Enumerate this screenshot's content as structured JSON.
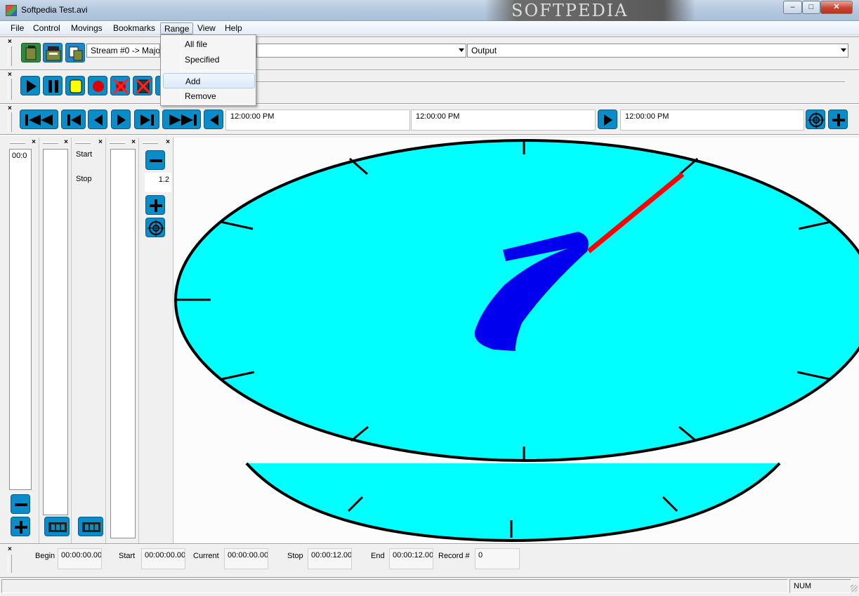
{
  "window": {
    "title": "Softpedia Test.avi",
    "watermark": "SOFTPEDIA",
    "controls": {
      "minimize": "–",
      "maximize": "□",
      "close": "✕"
    }
  },
  "menubar": {
    "items": [
      "File",
      "Control",
      "Movings",
      "Bookmarks",
      "Range",
      "View",
      "Help"
    ],
    "active": "Range"
  },
  "range_menu": {
    "items": [
      "All file",
      "Specified",
      "Add",
      "Remove"
    ],
    "highlighted": "Add"
  },
  "toolbar": {
    "close_glyph": "×",
    "stream_select": "Stream #0 -> Major",
    "output_select": "Output",
    "file_icons": [
      "open-file-icon",
      "save-file-icon",
      "copy-file-icon"
    ],
    "control_icons": [
      "play-icon",
      "pause-icon",
      "stop-icon",
      "record-icon",
      "cancel-cut-icon",
      "cancel-film-icon"
    ]
  },
  "navigation": {
    "icons": [
      "first-frame-icon",
      "previous-key-icon",
      "previous-frame-icon",
      "next-frame-icon",
      "next-key-icon",
      "last-frame-icon",
      "back-icon",
      "go-icon",
      "target-icon",
      "add-icon"
    ],
    "time_left": "12:00:00 PM",
    "time_mid": "12:00:00 PM",
    "time_right": "12:00:00 PM"
  },
  "panels": {
    "timecode_list_first": "00:0",
    "start_label": "Start",
    "stop_label": "Stop",
    "zoom_value": "1.2"
  },
  "info": {
    "begin_label": "Begin",
    "begin_value": "00:00:00.00",
    "start_label": "Start",
    "start_value": "00:00:00.00",
    "current_label": "Current",
    "current_value": "00:00:00.00",
    "stop_label": "Stop",
    "stop_value": "00:00:12.00",
    "end_label": "End",
    "end_value": "00:00:12.00",
    "record_label": "Record #",
    "record_value": "0"
  },
  "statusbar": {
    "num": "NUM"
  },
  "colors": {
    "clock_face": "#00ffff",
    "numeral": "#0000ee",
    "hand": "#ff0000",
    "button_blue": "#0a8cc8"
  }
}
